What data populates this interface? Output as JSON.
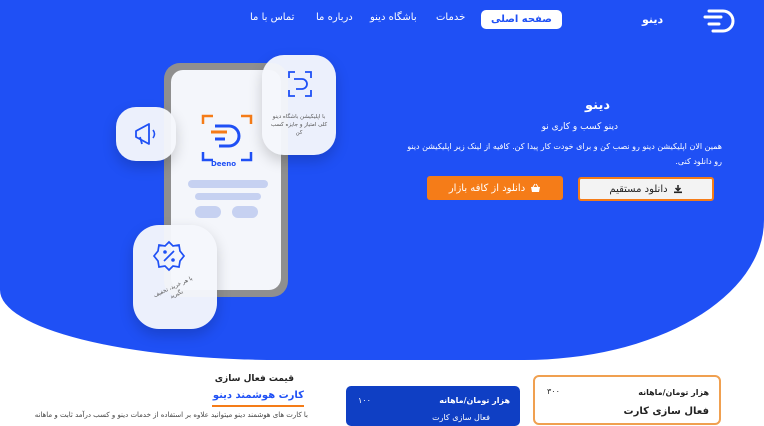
{
  "nav": {
    "logo_text": "دینو",
    "items": [
      "صفحه اصلی",
      "خدمات",
      "باشگاه دینو",
      "درباره ما",
      "تماس با ما"
    ]
  },
  "hero": {
    "title": "دینو",
    "subtitle": "دینو کسب و کاری نو",
    "description": "همین الان اپلیکیشن دینو رو نصب کن و برای خودت کار پیدا کن. کافیه از لینک زیر اپلیکیشن دینو رو دانلود کنی.",
    "btn_direct": "دانلود مستقیم",
    "btn_bazaar": "دانلود از کافه بازار",
    "phone_brand": "Deeno",
    "bubble_right_text": "با اپلیکیشن باشگاه دینو کلی امتیاز و جایزه کسب کن",
    "bubble_bottom_text": "با هر خرید، تخفیف بگیرید"
  },
  "pricing": {
    "section_title": "قیمت فعال سازی",
    "section_subtitle": "کارت هوشمند دینو",
    "section_desc": "با کارت های هوشمند دینو میتوانید علاوه بر استفاده از خدمات دینو و کسب درآمد ثابت و ماهانه",
    "blue_card": {
      "unit": "هزار تومان/ماهانه",
      "value": "۱۰۰",
      "label": "فعال سازی کارت"
    },
    "orange_card": {
      "unit": "هزار تومان/ماهانه",
      "value": "۳۰۰",
      "label": "فعال سازی کارت"
    }
  },
  "colors": {
    "primary": "#1f50f5",
    "accent": "#f57c18"
  }
}
